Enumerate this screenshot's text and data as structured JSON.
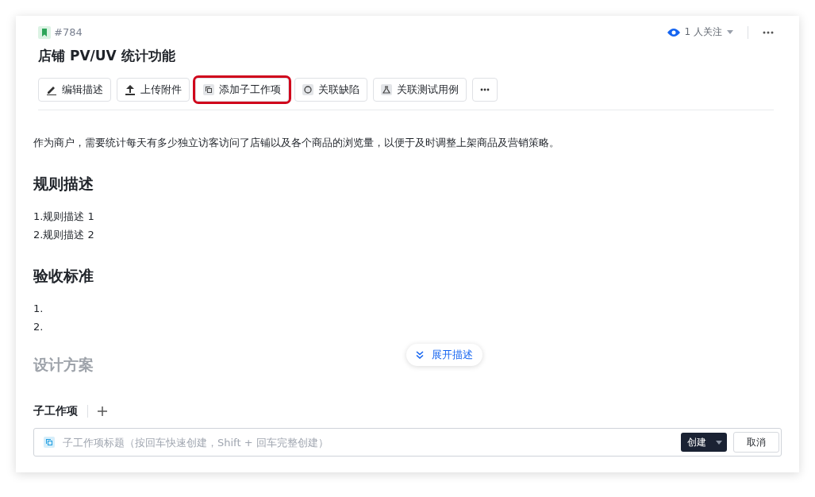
{
  "item": {
    "id": "#784",
    "title": "店铺 PV/UV 统计功能"
  },
  "watchers": {
    "label": "1 人关注"
  },
  "toolbar": [
    {
      "label": "编辑描述",
      "kind": "edit",
      "highlighted": false
    },
    {
      "label": "上传附件",
      "kind": "upload",
      "highlighted": false
    },
    {
      "label": "添加子工作项",
      "kind": "copy",
      "highlighted": true
    },
    {
      "label": "关联缺陷",
      "kind": "circle",
      "highlighted": false
    },
    {
      "label": "关联测试用例",
      "kind": "flask",
      "highlighted": false
    },
    {
      "kind": "more",
      "highlighted": false
    }
  ],
  "description": {
    "intro": "作为商户，需要统计每天有多少独立访客访问了店铺以及各个商品的浏览量，以便于及时调整上架商品及营销策略。",
    "sections": [
      {
        "heading": "规则描述",
        "faded": false,
        "lines": [
          "1.规则描述 1",
          "2.规则描述 2"
        ]
      },
      {
        "heading": "验收标准",
        "faded": false,
        "lines": [
          "1.",
          "2."
        ]
      },
      {
        "heading": "设计方案",
        "faded": true
      }
    ],
    "expand_button": "展开描述"
  },
  "subitems": {
    "title": "子工作项",
    "placeholder": "子工作项标题（按回车快速创建，Shift + 回车完整创建）",
    "create_button": "创建",
    "cancel_button": "取消"
  }
}
